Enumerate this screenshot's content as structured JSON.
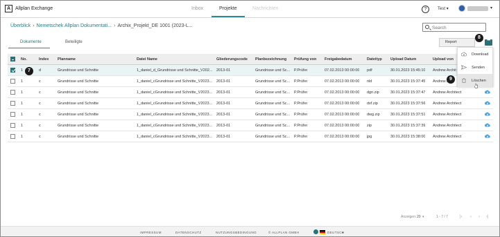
{
  "app": {
    "title": "Allplan Exchange",
    "logo_glyph": "A"
  },
  "nav": {
    "tabs": [
      "Inbox",
      "Projekte",
      "Nachrichten"
    ],
    "active": "Projekte"
  },
  "header": {
    "help_glyph": "?",
    "user_menu_label": "Test",
    "user_chevron": "▾"
  },
  "breadcrumb": {
    "items": [
      "Überblick",
      "Nemetschek Allplan Dokumentati...",
      "Archix_Projekt_DE 1001 (2023-L..."
    ],
    "separator": "›"
  },
  "search": {
    "placeholder": "Search",
    "value": ""
  },
  "subtabs": [
    "Dokumente",
    "Beteiligte"
  ],
  "toolbar": {
    "report_label": "Report",
    "more_label": "•••"
  },
  "menu": {
    "items": [
      "Download",
      "Senden",
      "Löschen"
    ]
  },
  "markers": {
    "m7": "7",
    "m8": "8",
    "m9": "9"
  },
  "table": {
    "columns": [
      "No.",
      "Index",
      "Planname",
      "Datei Name",
      "Gliederungscode",
      "Planbezeichnung",
      "Prüfung von",
      "Freigabedatum",
      "Dateityp",
      "Upload Datum",
      "Upload von"
    ],
    "rows": [
      {
        "no": "1",
        "index": "d",
        "planname": "Grundrisse und Schnitte",
        "datei": "1_daniel_d_Grundrisse und Schnitte_V202...",
        "code": "2013-01",
        "bez": "Grundrisse und Sc...",
        "pruefung": "P.Prüfer",
        "freigabe": "07.02.2013 00:00:00",
        "typ": "pdf",
        "upload": "30.01.2023 15:45:10",
        "von": "Andrew Archit",
        "checked": true
      },
      {
        "no": "1",
        "index": "c",
        "planname": "Grundrisse und Schnitte",
        "datei": "1_daniel_cGrundrisse und Schnitte_V2023...",
        "code": "2013-01",
        "bez": "Grundrisse und Sc...",
        "pruefung": "P.Prüfer",
        "freigabe": "07.02.2013 00:00:00",
        "typ": "nld",
        "upload": "30.01.2023 15:37:45",
        "von": "Andrew Ar",
        "checked": false
      },
      {
        "no": "1",
        "index": "c",
        "planname": "Grundrisse und Schnitte",
        "datei": "1_daniel_cGrundrisse und Schnitte_V2023...",
        "code": "2013-01",
        "bez": "Grundrisse und Sc...",
        "pruefung": "P.Prüfer",
        "freigabe": "07.02.2013 00:00:00",
        "typ": "dgn.zip",
        "upload": "30.01.2023 15:37:47",
        "von": "Andrew Architect",
        "checked": false
      },
      {
        "no": "1",
        "index": "c",
        "planname": "Grundrisse und Schnitte",
        "datei": "1_daniel_cGrundrisse und Schnitte_V2023...",
        "code": "2013-01",
        "bez": "Grundrisse und Sc...",
        "pruefung": "P.Prüfer",
        "freigabe": "07.02.2013 00:00:00",
        "typ": "dxf.zip",
        "upload": "30.01.2023 15:37:56",
        "von": "Andrew Architect",
        "checked": false
      },
      {
        "no": "1",
        "index": "c",
        "planname": "Grundrisse und Schnitte",
        "datei": "1_daniel_cGrundrisse und Schnitte_V2023...",
        "code": "2013-01",
        "bez": "Grundrisse und Sc...",
        "pruefung": "P.Prüfer",
        "freigabe": "07.02.2013 00:00:00",
        "typ": "dwg.zip",
        "upload": "30.01.2023 15:37:51",
        "von": "Andrew Architect",
        "checked": false
      },
      {
        "no": "1",
        "index": "c",
        "planname": "Grundrisse und Schnitte",
        "datei": "1_daniel_cGrundrisse und Schnitte_V2023...",
        "code": "2013-01",
        "bez": "Grundrisse und Sc...",
        "pruefung": "P.Prüfer",
        "freigabe": "07.02.2013 00:00:00",
        "typ": "zip",
        "upload": "30.01.2023 15:37:39",
        "von": "Andrew Architect",
        "checked": false
      },
      {
        "no": "1",
        "index": "c",
        "planname": "Grundrisse und Schnitte",
        "datei": "1_daniel_cGrundrisse und Schnitte_V2023...",
        "code": "2013-01",
        "bez": "Grundrisse und Sc...",
        "pruefung": "P.Prüfer",
        "freigabe": "07.02.2013 00:00:00",
        "typ": "jpg",
        "upload": "30.01.2023 15:38:00",
        "von": "Andrew Architect",
        "checked": false
      }
    ]
  },
  "pagination": {
    "label": "Anzeigen:",
    "per_page": "20",
    "range": "1 - 7 / 7",
    "first": "|‹",
    "prev": "‹",
    "next": "›",
    "last": "›|"
  },
  "footer": {
    "links": [
      "IMPRESSUM",
      "DATENSCHUTZ",
      "NUTZUNGSBEDINGUNG",
      "© ALLPLAN GMBH"
    ],
    "language": "DEUTSCH"
  },
  "colors": {
    "accent": "#2a7178",
    "link": "#2a7f86",
    "cloud": "#4aa3d8"
  }
}
